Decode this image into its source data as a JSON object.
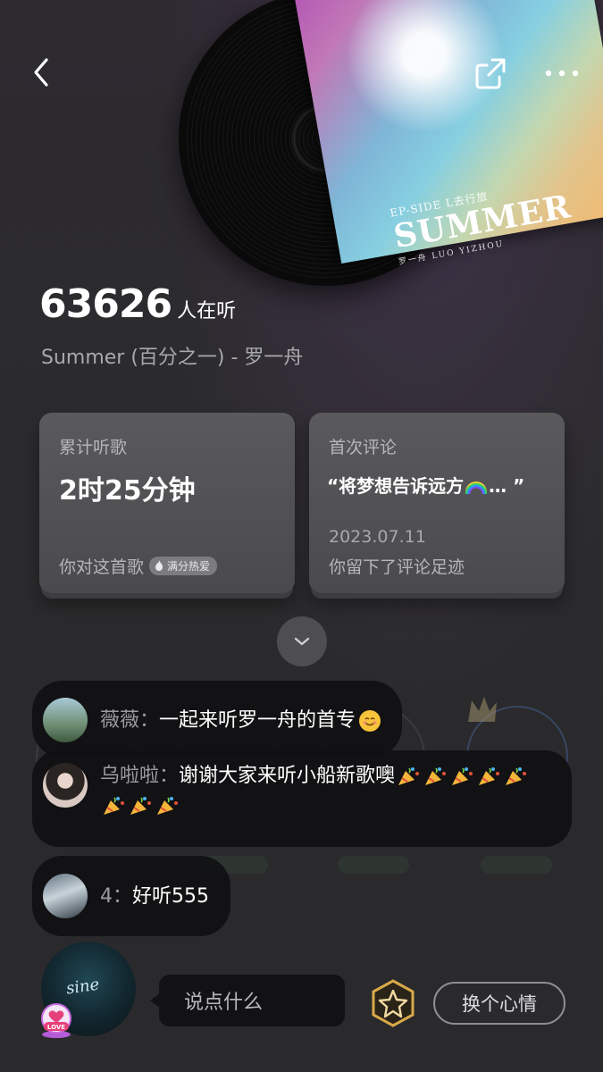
{
  "header": {
    "back_icon": "chevron-left-icon",
    "share_icon": "share-icon",
    "more_icon": "more-icon"
  },
  "cover": {
    "ep": "EP-SIDE L去行旅",
    "title": "SUMMER",
    "sub": "罗一舟 LUO YIZHOU"
  },
  "listeners": {
    "count": "63626",
    "suffix": "人在听"
  },
  "song": {
    "line": "Summer (百分之一) - 罗一舟"
  },
  "card_listen": {
    "label": "累计听歌",
    "value": "2时25分钟",
    "foot": "你对这首歌",
    "badge": "满分热爱"
  },
  "card_comment": {
    "label": "首次评论",
    "quote_open": "“将梦想告诉远方",
    "quote_close": "…  ”",
    "date": "2023.07.11",
    "foot": "你留下了评论足迹"
  },
  "comments": [
    {
      "nick": "薇薇：",
      "text": "一起来听罗一舟的首专"
    },
    {
      "nick": "乌啦啦：",
      "text": "谢谢大家来听小船新歌噢"
    },
    {
      "nick": "4：",
      "text": "好听555"
    }
  ],
  "bottom": {
    "avatar_text": "sine",
    "love_badge": "LOVE",
    "input_placeholder": "说点什么",
    "mood_button": "换个心情"
  },
  "colors": {
    "background": "#2a2a2c",
    "card": "#525255",
    "bubble": "#101012",
    "badge": "#7c7c80"
  }
}
